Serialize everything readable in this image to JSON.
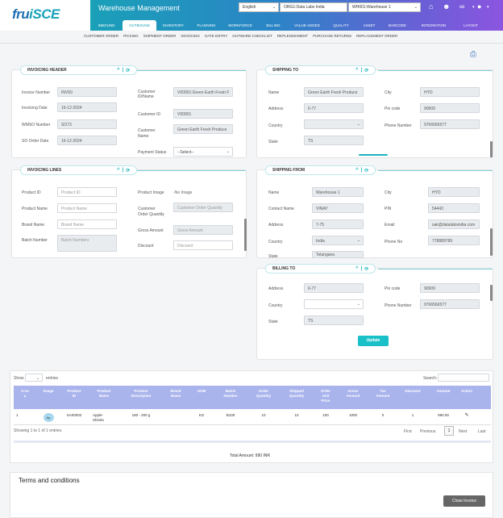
{
  "brand": {
    "logo_a": "fru",
    "logo_b": "iSCE"
  },
  "header": {
    "app_title": "Warehouse Management",
    "language": "English",
    "org": "ORG1:Data Labs India",
    "warehouse": "WH001:Warehouse 1"
  },
  "main_nav": [
    "INBOUND",
    "OUTBOUND",
    "INVENTORY",
    "PLANNING",
    "WORKFORCE",
    "BILLING",
    "VALUE-ADDED",
    "QUALITY",
    "ASSET",
    "BARCODE",
    "INTEGRATION",
    "LAYOUT"
  ],
  "sub_nav": [
    "CUSTOMER ORDER",
    "PICKING",
    "SHIPMENT ORDER",
    "INVOICING",
    "GATE ENTRY",
    "OUTWARD CHECKLIST",
    "REPLENISHMENT",
    "PURCHASE RETURNS",
    "REPLACEMENT ORDER"
  ],
  "invoicing_header": {
    "title": "INVOICING HEADER",
    "invoice_number_label": "Invoice Number",
    "invoice_number": "INV50",
    "invoicing_date_label": "Invoicing Date",
    "invoicing_date": "16-12-2024",
    "wmso_label": "WMSO Number",
    "wmso": "SO73",
    "so_date_label": "SO Order Date",
    "so_date": "16-12-2024",
    "cust_idname_label_1": "Customer",
    "cust_idname_label_2": "ID/Name",
    "cust_idname": "V00001:Green Earth Fresh F",
    "cust_id_label": "Customer ID",
    "cust_id": "V00001",
    "cust_name_label_1": "Customer",
    "cust_name_label_2": "Name",
    "cust_name": "Green Earth Fresh Produce",
    "payment_status_label": "Payment Status",
    "payment_status": "--Select--"
  },
  "shipping_to": {
    "title": "SHIPPING TO",
    "name_label": "Name",
    "name": "Green Earth Fresh Produce",
    "address_label": "Address",
    "address": "6-77",
    "country_label": "Country",
    "country": "",
    "state_label": "State",
    "state": "TS",
    "city_label": "City",
    "city": "HYD",
    "pin_label": "Pin code",
    "pin": "90909",
    "phone_label": "Phone Number",
    "phone": "9766566577"
  },
  "invoicing_lines": {
    "title": "INVOICING LINES",
    "product_id_label": "Product ID",
    "product_id_ph": "Product ID",
    "product_name_label": "Product Name",
    "product_name_ph": "Product Name",
    "brand_name_label": "Brand Name",
    "brand_name_ph": "Brand Name",
    "batch_label": "Batch Number",
    "batch_ph": "Batch Numbers",
    "product_image_label": "Product Image",
    "no_image": "No Image",
    "cust_qty_label_1": "Customer",
    "cust_qty_label_2": "Order Quantity",
    "cust_qty_ph": "Customer Order Quantity",
    "gross_label": "Gross Amount",
    "gross_ph": "Gross Amount",
    "discount_label": "Discount",
    "discount_ph": "Discount"
  },
  "shipping_from": {
    "title": "SHIPPING FROM",
    "name_label": "Name",
    "name": "Warehouse 1",
    "contact_label": "Contact Name",
    "contact": "VINAY",
    "address_label": "Address",
    "address": "7-75",
    "country_label": "Country",
    "country": "India",
    "state_label": "State",
    "state": "Telangana",
    "city_label": "City",
    "city": "HYD",
    "pin_label": "PIN",
    "pin": "54443",
    "email_label": "Email",
    "email": "sak@datalabsindia.com",
    "phone_label": "Phone No",
    "phone": "778889789"
  },
  "billing_to": {
    "title": "BILLING TO",
    "address_label": "Address",
    "address": "6-77",
    "country_label": "Country",
    "country": "",
    "state_label": "State",
    "state": "TS",
    "pin_label": "Pin code",
    "pin": "90909",
    "phone_label": "Phone Number",
    "phone": "9766566577",
    "update_label": "Update"
  },
  "table": {
    "show_label": "Show",
    "entries_label": "entries",
    "search_label": "Search:",
    "columns": [
      [
        "S.no",
        ""
      ],
      [
        "Image",
        ""
      ],
      [
        "Product",
        "ID"
      ],
      [
        "Product",
        "Name"
      ],
      [
        "Product",
        "Description"
      ],
      [
        "Brand",
        "Name"
      ],
      [
        "UOM",
        ""
      ],
      [
        "Batch",
        "Number"
      ],
      [
        "Order",
        "Quantity"
      ],
      [
        "Shipped",
        "Quantity"
      ],
      [
        "Order",
        "Unit",
        "Price"
      ],
      [
        "Gross",
        "Amount"
      ],
      [
        "Tax",
        "Amount"
      ],
      [
        "Discount",
        ""
      ],
      [
        "Amount",
        ""
      ],
      [
        "Action",
        ""
      ]
    ],
    "row": {
      "sno": "1",
      "image": "Ap",
      "product_id": "SA00002",
      "product_name_1": "Apple-",
      "product_name_2": "Shimla",
      "desc": "180 - 200 g",
      "brand": "",
      "uom": "KG",
      "batch": "B100",
      "order_qty": "10",
      "shipped_qty": "10",
      "unit_price": "100",
      "gross": "1000",
      "tax": "0",
      "discount": "1",
      "amount": "990.00"
    },
    "info": "Showing 1 to 1 of 1 entries",
    "first": "First",
    "previous": "Previous",
    "page": "1",
    "next": "Next",
    "last": "Last",
    "total": "Total Amount: 990 INR"
  },
  "terms": {
    "title": "Terms and conditions",
    "close_label": "Close Invoice"
  }
}
